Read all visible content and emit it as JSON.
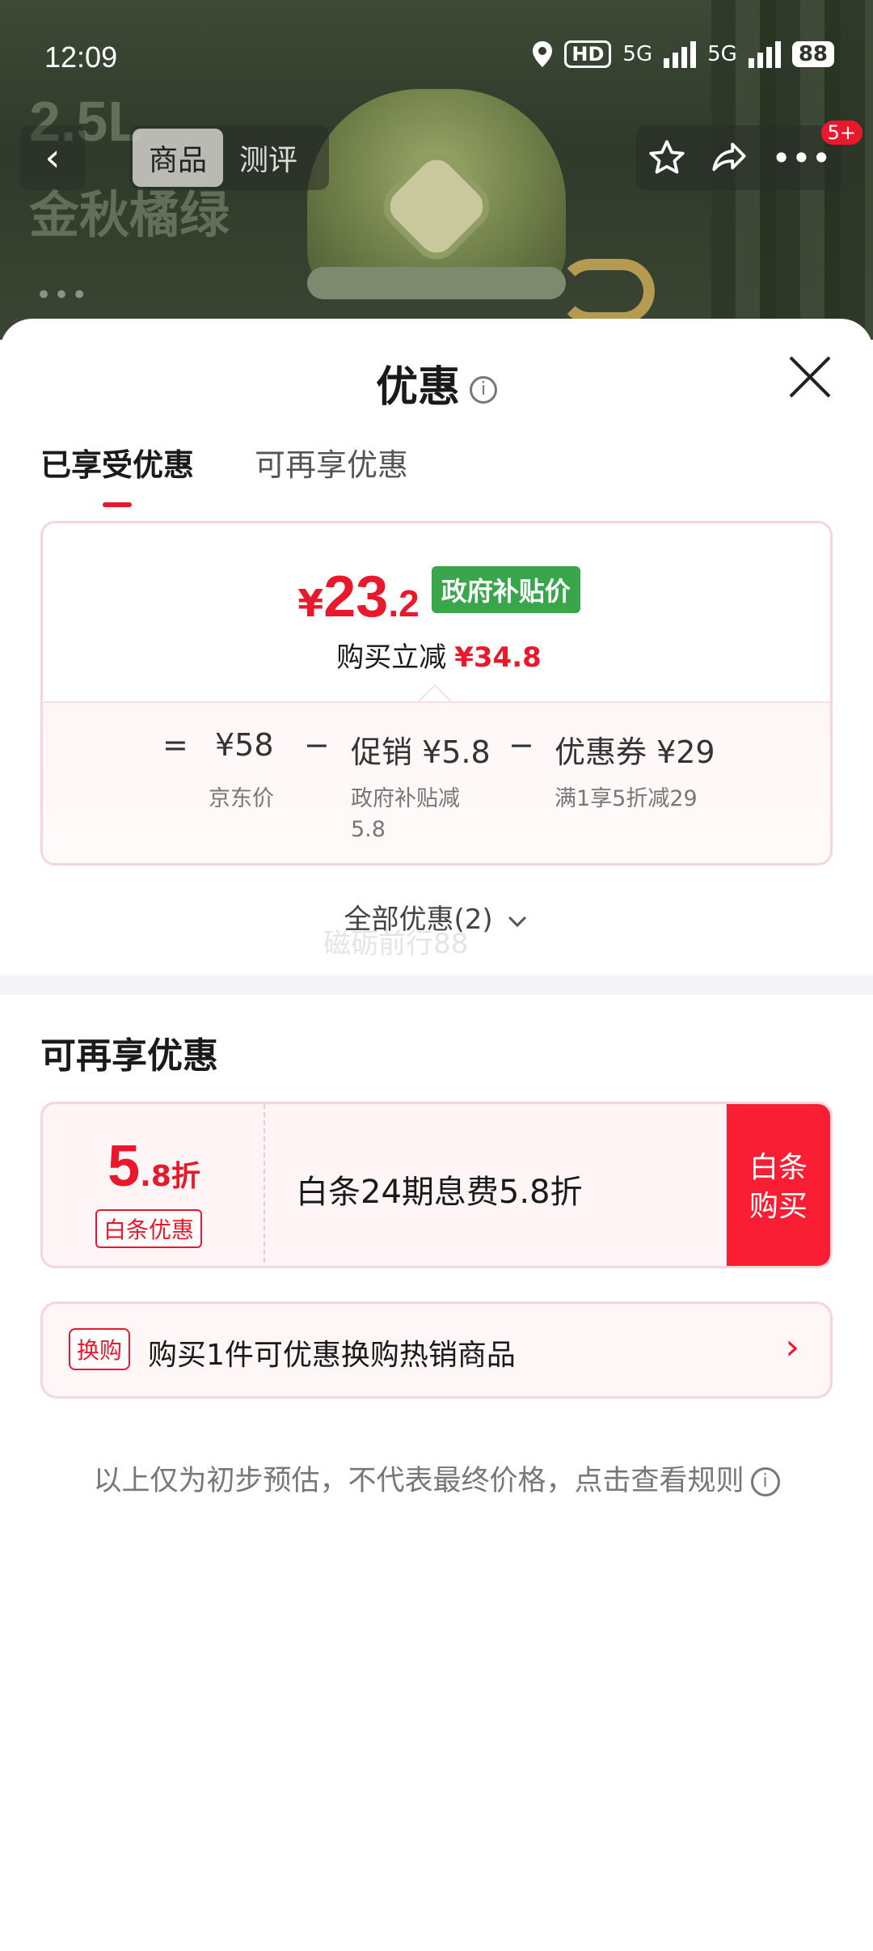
{
  "status_bar": {
    "time": "12:09",
    "hd_label": "HD",
    "net_label_1": "5G",
    "net_label_2": "5G",
    "battery": "88"
  },
  "background_page": {
    "ghost_line_1": "2.5L",
    "ghost_line_2": "金秋橘绿",
    "nav_tabs": [
      "商品",
      "测评"
    ],
    "active_nav_tab": "商品",
    "notification_badge": "5+"
  },
  "sheet": {
    "title": "优惠",
    "tabs": [
      "已享受优惠",
      "可再享优惠"
    ],
    "active_tab": "已享受优惠",
    "price_card": {
      "currency": "¥",
      "price_int": "23",
      "price_dec": ".2",
      "price_tag": "政府补贴价",
      "reduce_label": "购买立减",
      "reduce_amount": "¥34.8",
      "equals": "=",
      "minus_1": "−",
      "minus_2": "−",
      "base_price": "¥58",
      "base_label": "京东价",
      "promo_price": "促销 ¥5.8",
      "promo_label_line1": "政府补贴减",
      "promo_label_line2": "5.8",
      "coupon_price": "优惠券 ¥29",
      "coupon_label": "满1享5折减29"
    },
    "all_offers_label": "全部优惠(2)",
    "watermark": "磁砺前行88",
    "section_title": "可再享优惠",
    "coupon": {
      "discount_int": "5",
      "discount_rest": ".8折",
      "tag": "白条优惠",
      "description": "白条24期息费5.8折",
      "button_line1": "白条",
      "button_line2": "购买"
    },
    "swap": {
      "tag": "换购",
      "text": "购买1件可优惠换购热销商品"
    },
    "disclaimer": "以上仅为初步预估，不代表最终价格，点击查看规则"
  },
  "colors": {
    "accent_red": "#e8192c",
    "button_red": "#fa1e35",
    "gov_green": "#3aa64b"
  }
}
